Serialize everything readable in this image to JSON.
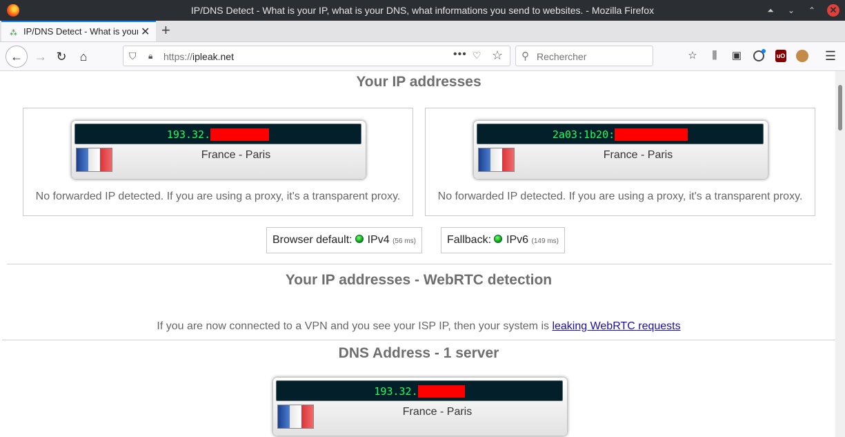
{
  "window": {
    "title": "IP/DNS Detect - What is your IP, what is your DNS, what informations you send to websites. - Mozilla Firefox",
    "controls": {
      "minimize": "⏶",
      "restore": "⌄",
      "maximize": "⌃",
      "close": "✕"
    }
  },
  "tabs": [
    {
      "title": "IP/DNS Detect - What is your IP",
      "close": "✕",
      "active": true
    }
  ],
  "new_tab": "+",
  "nav": {
    "back": "←",
    "forward": "→",
    "reload": "↻",
    "home": "⌂",
    "url_prefix": "https://",
    "url_host": "ipleak.net",
    "page_actions": "•••",
    "search_placeholder": "Rechercher"
  },
  "toolbar_icons": [
    "bookmarks-star-icon",
    "library-icon",
    "sidebar-icon",
    "account-icon",
    "ublock-origin-icon",
    "cookie-extension-icon",
    "menu-icon"
  ],
  "ublock_label": "uO",
  "colors": {
    "lcd_bg": "#03202a",
    "lcd_text": "#1aff5c",
    "redaction": "#ff0000",
    "flag_blue": "#1f4fa8",
    "flag_white": "#f4f4f4",
    "flag_red": "#d8343a",
    "link": "#1a0dab"
  },
  "section_ip": {
    "heading": "Your IP addresses",
    "boxes": [
      {
        "ip": "193.32.",
        "location": "France - Paris",
        "note": "No forwarded IP detected. If you are using a proxy, it's a transparent proxy."
      },
      {
        "ip": "2a03:1b20:",
        "location": "France - Paris",
        "note": "No forwarded IP detected. If you are using a proxy, it's a transparent proxy."
      }
    ],
    "protocols": [
      {
        "label": "Browser default:",
        "proto": "IPv4",
        "latency": "(56 ms)"
      },
      {
        "label": "Fallback:",
        "proto": "IPv6",
        "latency": "(149 ms)"
      }
    ]
  },
  "section_webrtc": {
    "heading": "Your IP addresses - WebRTC detection",
    "note_prefix": "If you are now connected to a VPN and you see your ISP IP, then your system is ",
    "note_link": "leaking WebRTC requests"
  },
  "section_dns": {
    "heading": "DNS Address - 1 server",
    "server": {
      "ip": "193.32.",
      "location": "France - Paris"
    }
  }
}
